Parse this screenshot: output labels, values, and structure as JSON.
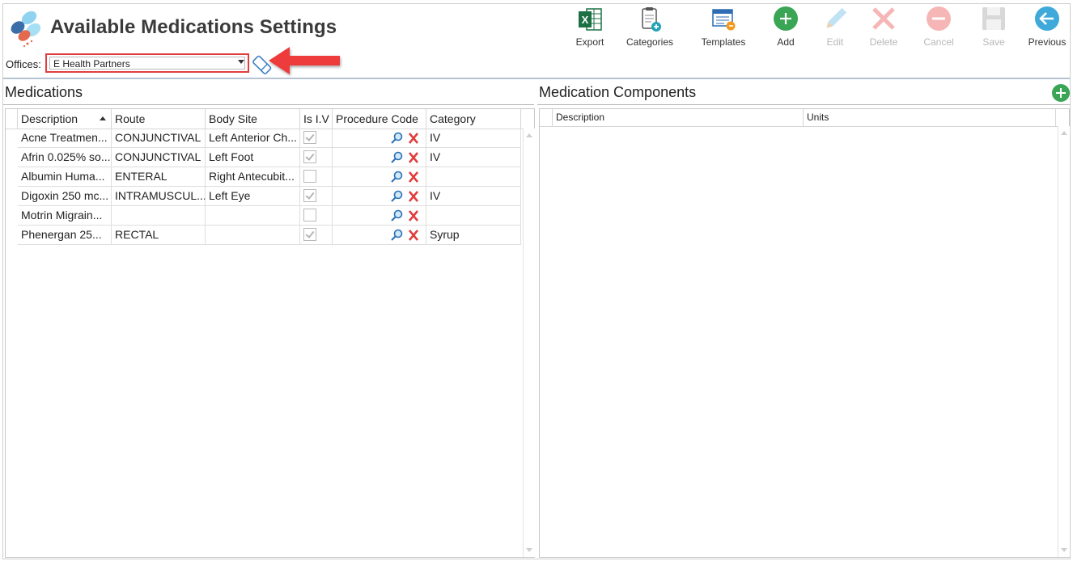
{
  "header": {
    "title": "Available Medications Settings",
    "offices_label": "Offices:",
    "offices_selected": "E Health Partners"
  },
  "toolbar": {
    "export": "Export",
    "categories": "Categories",
    "templates": "Templates",
    "add": "Add",
    "edit": "Edit",
    "delete": "Delete",
    "cancel": "Cancel",
    "save": "Save",
    "previous": "Previous"
  },
  "medications": {
    "title": "Medications",
    "columns": [
      "Description",
      "Route",
      "Body Site",
      "Is I.V",
      "Procedure Code",
      "Category"
    ],
    "rows": [
      {
        "description": "Acne Treatmen...",
        "route": "CONJUNCTIVAL",
        "body_site": "Left Anterior Ch...",
        "is_iv": true,
        "category": "IV"
      },
      {
        "description": "Afrin 0.025% so...",
        "route": "CONJUNCTIVAL",
        "body_site": "Left Foot",
        "is_iv": true,
        "category": "IV"
      },
      {
        "description": "Albumin Huma...",
        "route": "ENTERAL",
        "body_site": "Right Antecubit...",
        "is_iv": false,
        "category": ""
      },
      {
        "description": "Digoxin 250 mc...",
        "route": "INTRAMUSCUL...",
        "body_site": "Left Eye",
        "is_iv": true,
        "category": "IV"
      },
      {
        "description": "Motrin Migrain...",
        "route": "",
        "body_site": "",
        "is_iv": false,
        "category": ""
      },
      {
        "description": "Phenergan 25...",
        "route": "RECTAL",
        "body_site": "",
        "is_iv": true,
        "category": "Syrup"
      }
    ]
  },
  "components": {
    "title": "Medication Components",
    "columns": [
      "Description",
      "Units"
    ]
  },
  "colors": {
    "accent_red": "#e23d3d",
    "add_green": "#3aa655",
    "header_rule": "#b5c3d4"
  }
}
